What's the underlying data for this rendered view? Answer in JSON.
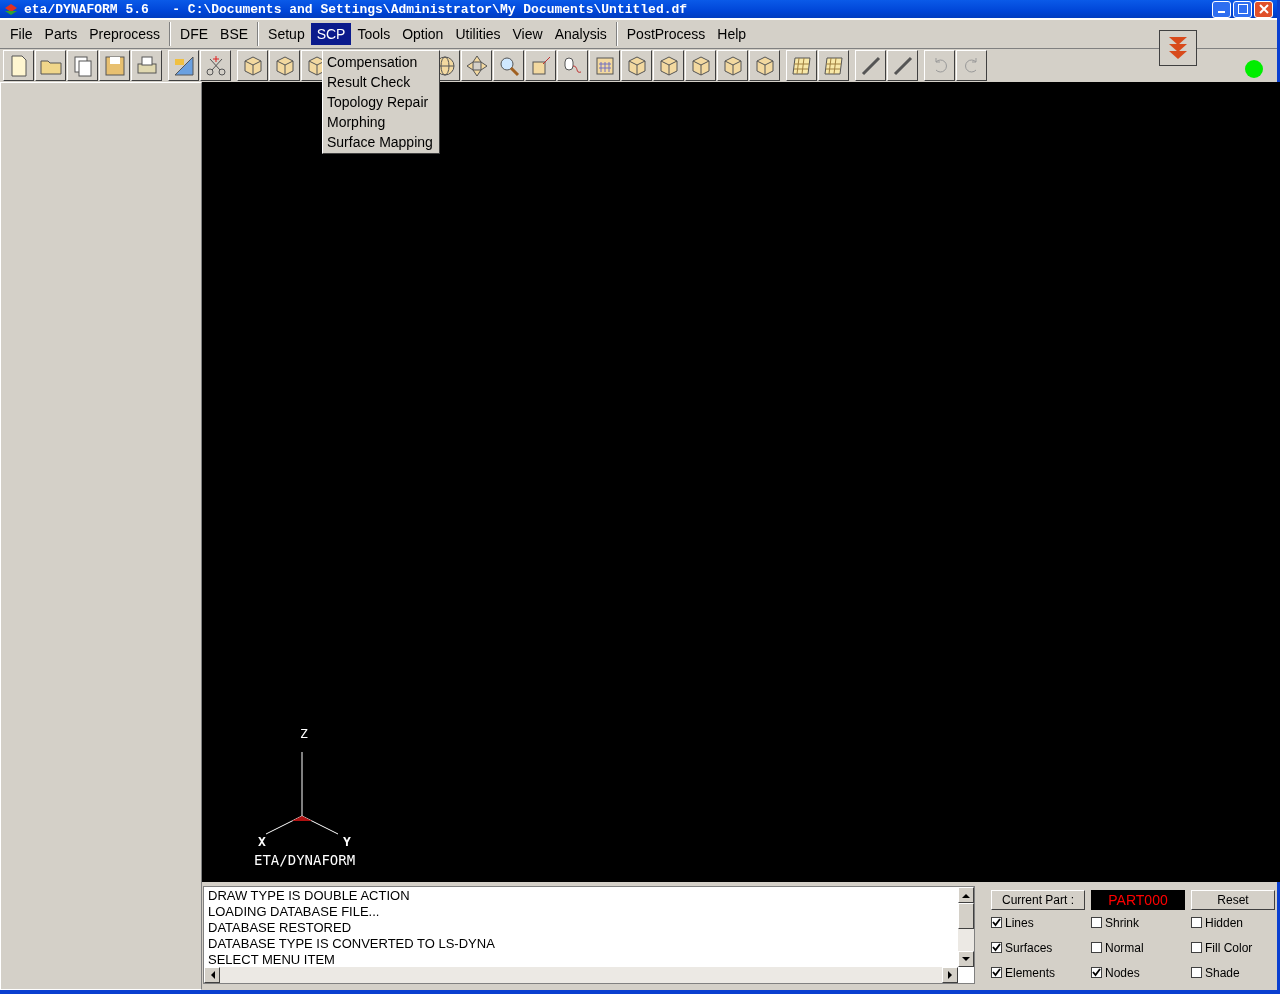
{
  "window": {
    "title": "eta/DYNAFORM 5.6   - C:\\Documents and Settings\\Administrator\\My Documents\\Untitled.df"
  },
  "menu_groups": [
    [
      {
        "label": "File",
        "selected": false
      },
      {
        "label": "Parts",
        "selected": false
      },
      {
        "label": "Preprocess",
        "selected": false
      }
    ],
    [
      {
        "label": "DFE",
        "selected": false
      },
      {
        "label": "BSE",
        "selected": false
      }
    ],
    [
      {
        "label": "Setup",
        "selected": false
      },
      {
        "label": "SCP",
        "selected": true
      },
      {
        "label": "Tools",
        "selected": false
      },
      {
        "label": "Option",
        "selected": false
      },
      {
        "label": "Utilities",
        "selected": false
      },
      {
        "label": "View",
        "selected": false
      },
      {
        "label": "Analysis",
        "selected": false
      }
    ],
    [
      {
        "label": "PostProcess",
        "selected": false
      },
      {
        "label": "Help",
        "selected": false
      }
    ]
  ],
  "dropdown": {
    "items": [
      "Compensation",
      "Result Check",
      "Topology Repair",
      "Morphing",
      "Surface Mapping"
    ]
  },
  "viewport": {
    "axes": {
      "z": "Z",
      "x": "X",
      "y": "Y"
    },
    "caption": "ETA/DYNAFORM"
  },
  "messages": [
    "DRAW TYPE IS DOUBLE ACTION",
    "LOADING DATABASE FILE...",
    "DATABASE RESTORED",
    "DATABASE TYPE IS CONVERTED TO LS-DYNA",
    "SELECT MENU ITEM"
  ],
  "display_panel": {
    "current_part_label": "Current Part :",
    "current_part": "PART000",
    "reset": "Reset",
    "options": [
      {
        "label": "Lines",
        "checked": true
      },
      {
        "label": "Shrink",
        "checked": false
      },
      {
        "label": "Hidden",
        "checked": false
      },
      {
        "label": "Surfaces",
        "checked": true
      },
      {
        "label": "Normal",
        "checked": false
      },
      {
        "label": "Fill Color",
        "checked": false
      },
      {
        "label": "Elements",
        "checked": true
      },
      {
        "label": "Nodes",
        "checked": true
      },
      {
        "label": "Shade",
        "checked": false
      }
    ]
  }
}
